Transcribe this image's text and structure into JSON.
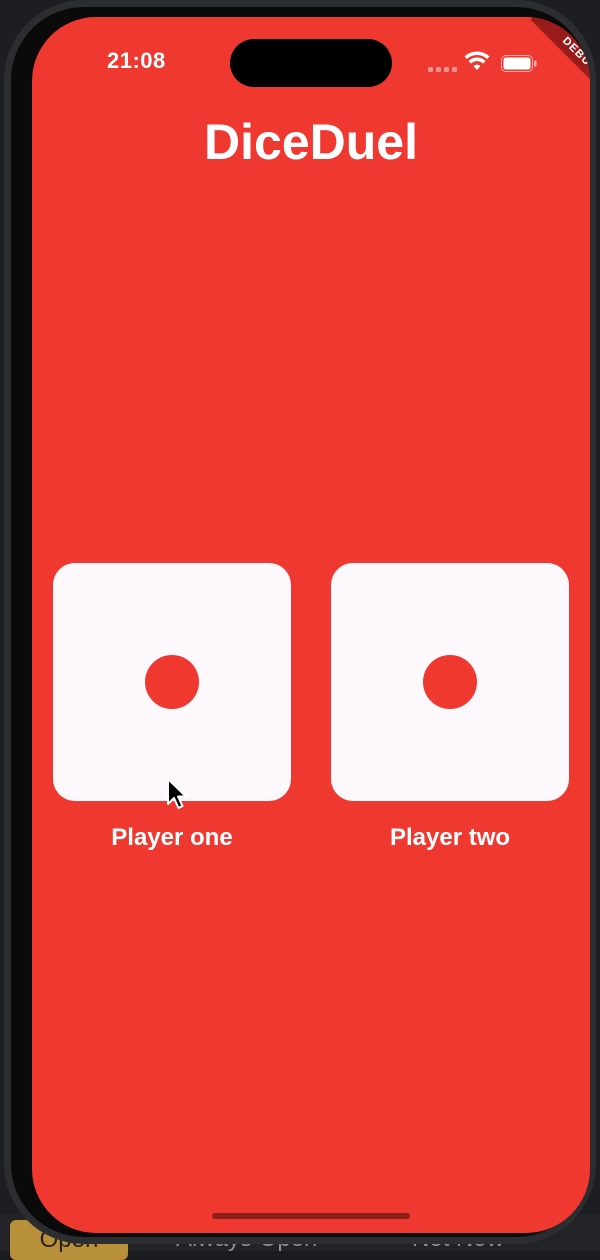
{
  "status_bar": {
    "time": "21:08",
    "debug_label": "DEBUG"
  },
  "app": {
    "title": "DiceDuel",
    "background_color": "#ee3830"
  },
  "dice": [
    {
      "player_label": "Player one",
      "face_value": 1
    },
    {
      "player_label": "Player two",
      "face_value": 1
    }
  ],
  "host_bar": {
    "open_label": "Open",
    "always_open_label": "Always Open",
    "not_now_label": "Not Now"
  },
  "icons": {
    "wifi": "wifi-icon",
    "battery": "battery-icon",
    "signal": "cellular-signal-icon",
    "cursor": "mouse-pointer-icon"
  }
}
